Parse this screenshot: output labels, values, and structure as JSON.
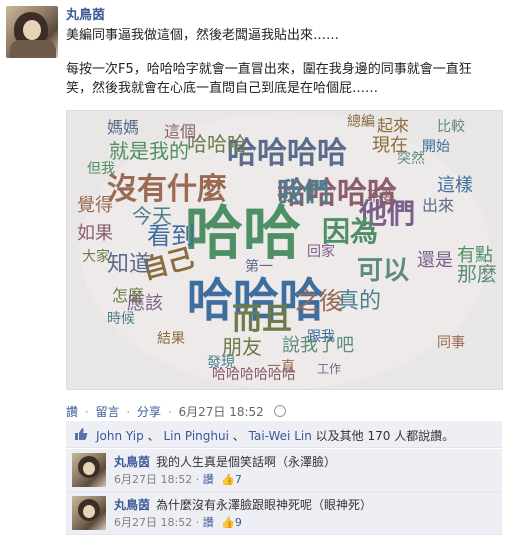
{
  "post": {
    "author": "丸鳥茵",
    "line1": "美編同事逼我做這個，然後老闆逼我貼出來……",
    "para": "每按一次F5，哈哈哈字就會一直冒出來，圍在我身邊的同事就會一直狂笑，然後我就會在心底一直問自己到底是在哈個屁……",
    "cloud_words": [
      "哈哈",
      "哈哈哈",
      "哈哈哈哈",
      "哈哈哈哈",
      "哈哈哈",
      "沒有什麼",
      "我們",
      "他們",
      "可以",
      "自己",
      "因為",
      "看到",
      "知道",
      "如果",
      "而且",
      "之後",
      "真的",
      "應該",
      "那麼",
      "現在",
      "就是我的",
      "這樣",
      "媽媽",
      "這個",
      "朋友",
      "覺得",
      "今天",
      "還是",
      "說我了吧",
      "起來",
      "有點",
      "跟我",
      "第一",
      "哈哈哈哈哈哈",
      "怎麼",
      "同事",
      "時候",
      "回家",
      "突然",
      "結果",
      "但我",
      "開始",
      "出來",
      "不要",
      "大家",
      "一直",
      "發現",
      "工作",
      "比較",
      "總編"
    ]
  },
  "actions": {
    "like": "讚",
    "comment": "留言",
    "share": "分享",
    "date": "6月27日 18:52"
  },
  "likes": {
    "u1": "John Yip",
    "sep": "、",
    "u2": "Lin Pinghui",
    "u3": "Tai-Wei Lin",
    "tail": "以及其他 170 人都說讚。"
  },
  "comments": [
    {
      "author": "丸鳥茵",
      "text": "我的人生真是個笑話啊（永澤臉）",
      "date": "6月27日 18:52",
      "like": "讚",
      "count": "7"
    },
    {
      "author": "丸鳥茵",
      "text": "為什麼沒有永澤臉跟眼神死呢（眼神死）",
      "date": "6月27日 18:52",
      "like": "讚",
      "count": "9"
    }
  ]
}
